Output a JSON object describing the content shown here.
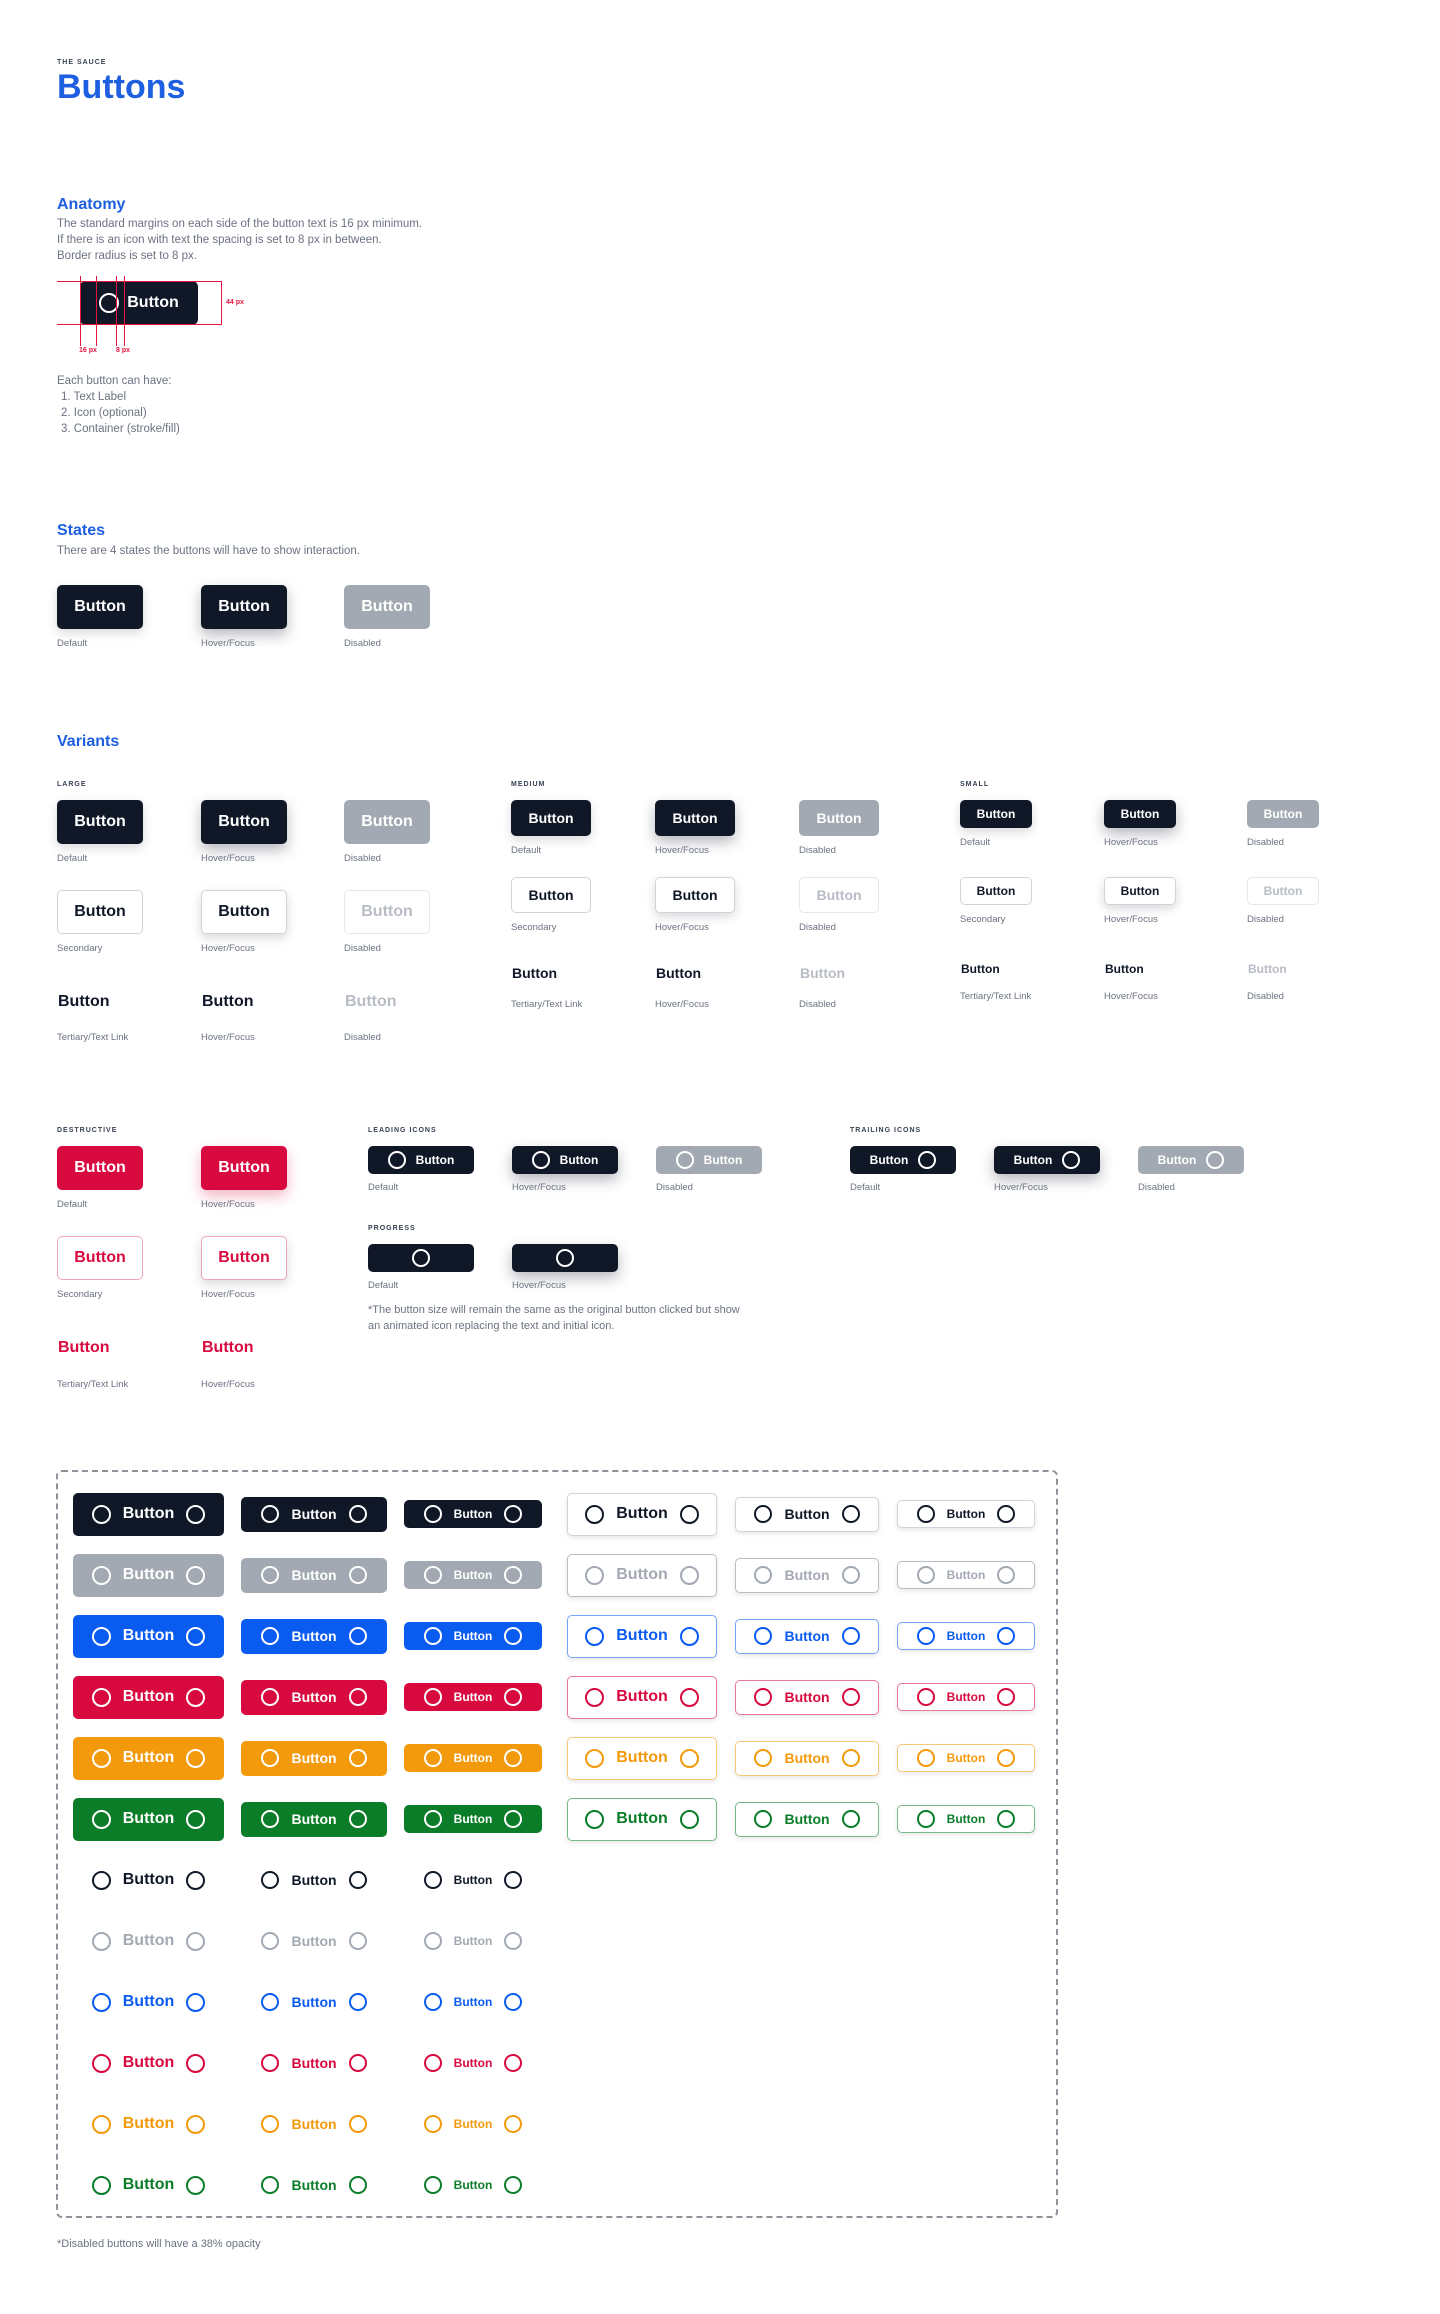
{
  "header": {
    "eyebrow": "THE SAUCE",
    "title": "Buttons"
  },
  "colors": {
    "accent": "#1d5fe0",
    "primary": "#101828",
    "disabled": "#a3a9b2",
    "blue": "#0a5bf0",
    "red": "#d8093e",
    "orange": "#f29a0b",
    "green": "#0b7d29"
  },
  "anatomy": {
    "title": "Anatomy",
    "lines": [
      "The standard margins on each side of the button text is 16 px minimum.",
      "If there is an icon with text the spacing is set to 8 px in between.",
      "Border radius is set to 8 px."
    ],
    "button_label": "Button",
    "height_label": "44 px",
    "margin_label": "16 px",
    "gap_label": "8 px",
    "list_title": "Each button can have:",
    "list": [
      "1. Text Label",
      "2. Icon (optional)",
      "3. Container (stroke/fill)"
    ]
  },
  "states": {
    "title": "States",
    "desc": "There are 4 states the buttons will have to show interaction.",
    "items": [
      {
        "label": "Button",
        "caption": "Default"
      },
      {
        "label": "Button",
        "caption": "Hover/Focus"
      },
      {
        "label": "Button",
        "caption": "Disabled"
      }
    ]
  },
  "variants": {
    "title": "Variants",
    "sizes": [
      {
        "heading": "LARGE",
        "rows": [
          [
            {
              "label": "Button",
              "caption": "Default"
            },
            {
              "label": "Button",
              "caption": "Hover/Focus"
            },
            {
              "label": "Button",
              "caption": "Disabled"
            }
          ],
          [
            {
              "label": "Button",
              "caption": "Secondary"
            },
            {
              "label": "Button",
              "caption": "Hover/Focus"
            },
            {
              "label": "Button",
              "caption": "Disabled"
            }
          ],
          [
            {
              "label": "Button",
              "caption": "Tertiary/Text Link"
            },
            {
              "label": "Button",
              "caption": "Hover/Focus"
            },
            {
              "label": "Button",
              "caption": "Disabled"
            }
          ]
        ]
      },
      {
        "heading": "MEDIUM",
        "rows": [
          [
            {
              "label": "Button",
              "caption": "Default"
            },
            {
              "label": "Button",
              "caption": "Hover/Focus"
            },
            {
              "label": "Button",
              "caption": "Disabled"
            }
          ],
          [
            {
              "label": "Button",
              "caption": "Secondary"
            },
            {
              "label": "Button",
              "caption": "Hover/Focus"
            },
            {
              "label": "Button",
              "caption": "Disabled"
            }
          ],
          [
            {
              "label": "Button",
              "caption": "Tertiary/Text Link"
            },
            {
              "label": "Button",
              "caption": "Hover/Focus"
            },
            {
              "label": "Button",
              "caption": "Disabled"
            }
          ]
        ]
      },
      {
        "heading": "SMALL",
        "rows": [
          [
            {
              "label": "Button",
              "caption": "Default"
            },
            {
              "label": "Button",
              "caption": "Hover/Focus"
            },
            {
              "label": "Button",
              "caption": "Disabled"
            }
          ],
          [
            {
              "label": "Button",
              "caption": "Secondary"
            },
            {
              "label": "Button",
              "caption": "Hover/Focus"
            },
            {
              "label": "Button",
              "caption": "Disabled"
            }
          ],
          [
            {
              "label": "Button",
              "caption": "Tertiary/Text Link"
            },
            {
              "label": "Button",
              "caption": "Hover/Focus"
            },
            {
              "label": "Button",
              "caption": "Disabled"
            }
          ]
        ]
      }
    ],
    "destructive": {
      "heading": "DESTRUCTIVE",
      "rows": [
        [
          {
            "label": "Button",
            "caption": "Default"
          },
          {
            "label": "Button",
            "caption": "Hover/Focus"
          }
        ],
        [
          {
            "label": "Button",
            "caption": "Secondary"
          },
          {
            "label": "Button",
            "caption": "Hover/Focus"
          }
        ],
        [
          {
            "label": "Button",
            "caption": "Tertiary/Text Link"
          },
          {
            "label": "Button",
            "caption": "Hover/Focus"
          }
        ]
      ]
    },
    "leading": {
      "heading": "LEADING ICONS",
      "items": [
        {
          "label": "Button",
          "caption": "Default"
        },
        {
          "label": "Button",
          "caption": "Hover/Focus"
        },
        {
          "label": "Button",
          "caption": "Disabled"
        }
      ]
    },
    "trailing": {
      "heading": "TRAILING ICONS",
      "items": [
        {
          "label": "Button",
          "caption": "Default"
        },
        {
          "label": "Button",
          "caption": "Hover/Focus"
        },
        {
          "label": "Button",
          "caption": "Disabled"
        }
      ]
    },
    "progress": {
      "heading": "PROGRESS",
      "items": [
        {
          "caption": "Default"
        },
        {
          "caption": "Hover/Focus"
        }
      ],
      "note": "*The button size will remain the same as the original button clicked but show an animated icon replacing the text and initial icon."
    }
  },
  "matrix": {
    "label": "Button",
    "row_colors": [
      "#101828",
      "#a3a9b2",
      "#0a5bf0",
      "#d8093e",
      "#f29a0b",
      "#0b7d29"
    ],
    "footnote": "*Disabled buttons will have a 38% opacity"
  }
}
